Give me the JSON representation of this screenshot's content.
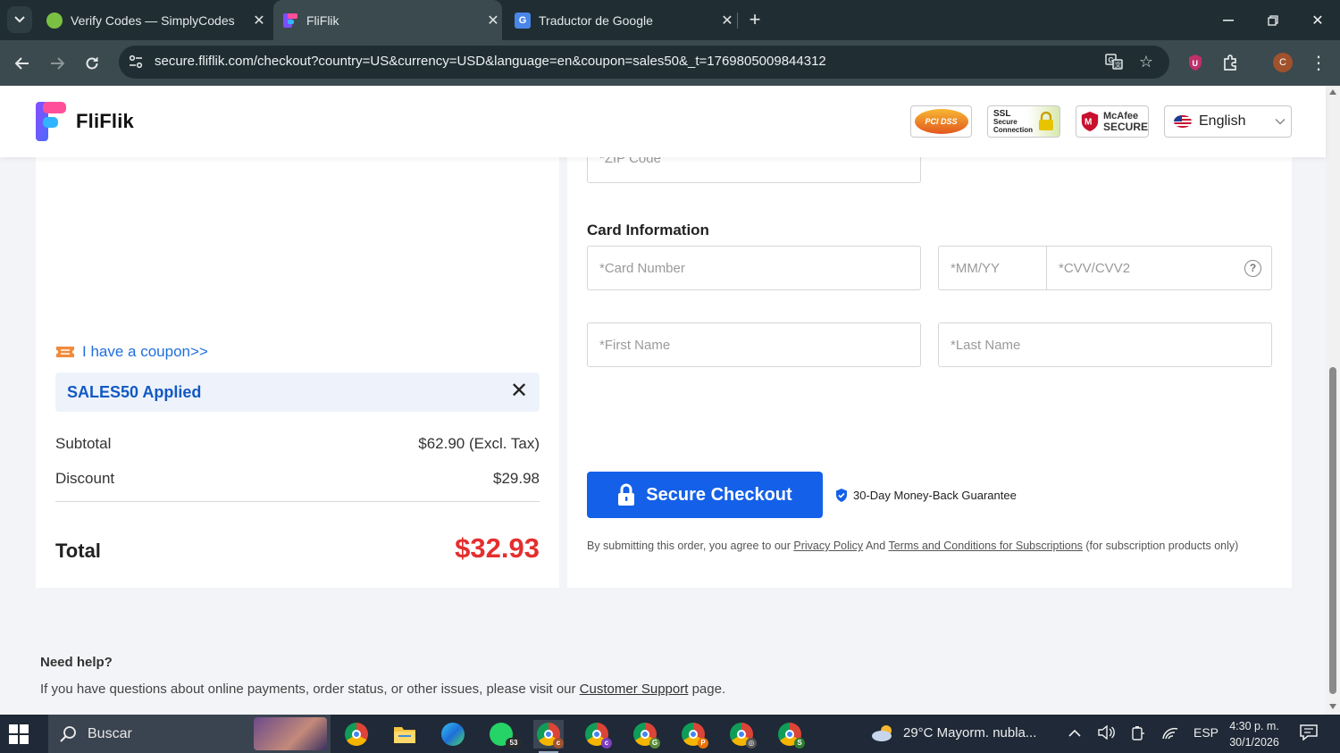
{
  "browser": {
    "tabs": [
      {
        "label": "Verify Codes — SimplyCodes",
        "active": false
      },
      {
        "label": "FliFlik",
        "active": true
      },
      {
        "label": "Traductor de Google",
        "active": false
      }
    ],
    "url": "secure.fliflik.com/checkout?country=US&currency=USD&language=en&coupon=sales50&_t=1769805009844312",
    "profile_initial": "C",
    "extension_letter": "U"
  },
  "header": {
    "brand": "FliFlik",
    "badges": {
      "pci": "PCI DSS",
      "ssl_line1": "SSL",
      "ssl_line2": "Secure",
      "ssl_line3": "Connection",
      "mcafee_line1": "McAfee",
      "mcafee_line2": "SECURE"
    },
    "language": "English"
  },
  "order_summary": {
    "coupon_link": "I have a coupon>>",
    "coupon_applied": "SALES50 Applied",
    "subtotal_label": "Subtotal",
    "subtotal_value": "$62.90 (Excl. Tax)",
    "discount_label": "Discount",
    "discount_value": "$29.98",
    "total_label": "Total",
    "total_value": "$32.93"
  },
  "payment": {
    "zip_placeholder": "*ZIP Code",
    "section_title": "Card Information",
    "card_number_placeholder": "*Card Number",
    "expiry_placeholder": "*MM/YY",
    "cvv_placeholder": "*CVV/CVV2",
    "first_name_placeholder": "*First Name",
    "last_name_placeholder": "*Last Name",
    "checkout_button": "Secure Checkout",
    "guarantee": "30-Day Money-Back Guarantee",
    "terms_prefix": "By submitting this order, you agree to our ",
    "privacy_link": "Privacy Policy",
    "terms_and": " And ",
    "terms_link": "Terms and Conditions for Subscriptions",
    "terms_suffix": " (for subscription products only)"
  },
  "help": {
    "title": "Need help?",
    "text_prefix": "If you have questions about online payments, order status, or other issues, please visit our ",
    "link": "Customer Support",
    "text_suffix": " page."
  },
  "taskbar": {
    "search_label": "Buscar",
    "whatsapp_badge": "53",
    "weather": "29°C  Mayorm. nubla...",
    "language": "ESP",
    "time": "4:30 p. m.",
    "date": "30/1/2026"
  },
  "colors": {
    "accent": "#1460e8",
    "total": "#e42f2f",
    "coupon": "#1259c3",
    "chrome_dark": "#202e33",
    "chrome_toolbar": "#3b4a4f"
  }
}
